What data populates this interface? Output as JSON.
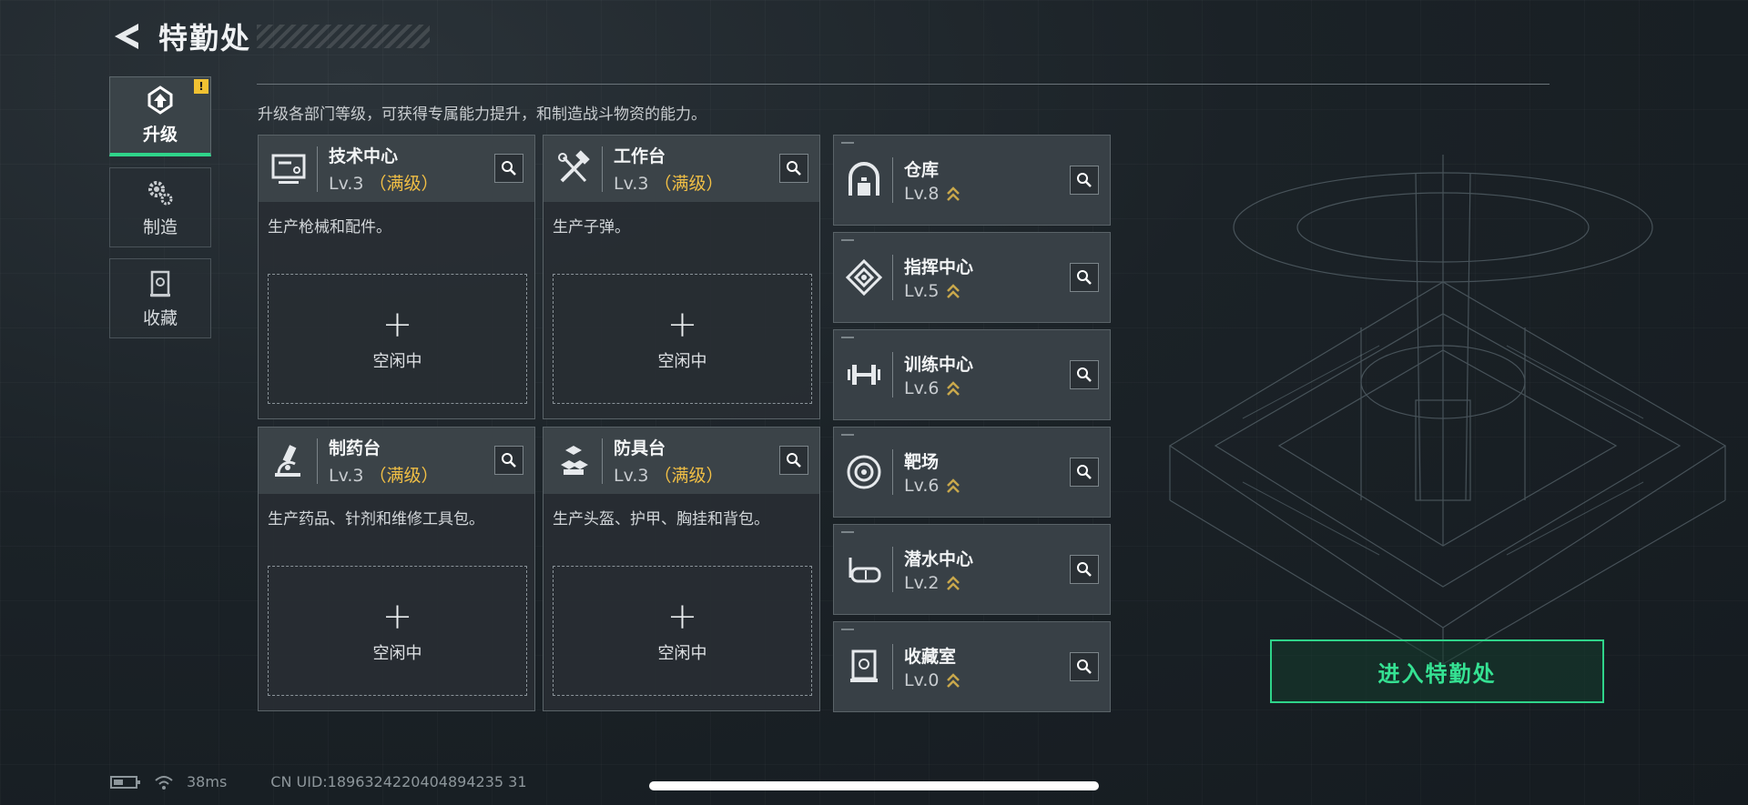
{
  "header": {
    "title": "特勤处"
  },
  "nav": {
    "items": [
      {
        "label": "升级",
        "icon": "upgrade-icon",
        "active": true,
        "badge": "!"
      },
      {
        "label": "制造",
        "icon": "gears-icon",
        "active": false
      },
      {
        "label": "收藏",
        "icon": "collection-icon",
        "active": false
      }
    ]
  },
  "description": "升级各部门等级，可获得专属能力提升，和制造战斗物资的能力。",
  "big_cards": [
    {
      "name": "技术中心",
      "level": "Lv.3",
      "max_label": "（满级）",
      "desc": "生产枪械和配件。",
      "icon": "monitor-icon"
    },
    {
      "name": "工作台",
      "level": "Lv.3",
      "max_label": "（满级）",
      "desc": "生产子弹。",
      "icon": "tools-icon"
    },
    {
      "name": "制药台",
      "level": "Lv.3",
      "max_label": "（满级）",
      "desc": "生产药品、针剂和维修工具包。",
      "icon": "microscope-icon"
    },
    {
      "name": "防具台",
      "level": "Lv.3",
      "max_label": "（满级）",
      "desc": "生产头盔、护甲、胸挂和背包。",
      "icon": "armor-icon"
    }
  ],
  "slot": {
    "plus": "+",
    "label": "空闲中"
  },
  "small_cards": [
    {
      "name": "仓库",
      "level": "Lv.8",
      "icon": "warehouse-icon"
    },
    {
      "name": "指挥中心",
      "level": "Lv.5",
      "icon": "command-icon"
    },
    {
      "name": "训练中心",
      "level": "Lv.6",
      "icon": "dumbbell-icon"
    },
    {
      "name": "靶场",
      "level": "Lv.6",
      "icon": "target-icon"
    },
    {
      "name": "潜水中心",
      "level": "Lv.2",
      "icon": "diving-mask-icon"
    },
    {
      "name": "收藏室",
      "level": "Lv.0",
      "icon": "collection-room-icon"
    }
  ],
  "enter_button": {
    "label": "进入特勤处"
  },
  "status": {
    "ping": "38ms",
    "uid": "CN UID:1896324220404894235 31"
  },
  "colors": {
    "accent_green": "#2fd48a",
    "max_gold": "#f1bf45",
    "badge_yellow": "#f1c232"
  }
}
